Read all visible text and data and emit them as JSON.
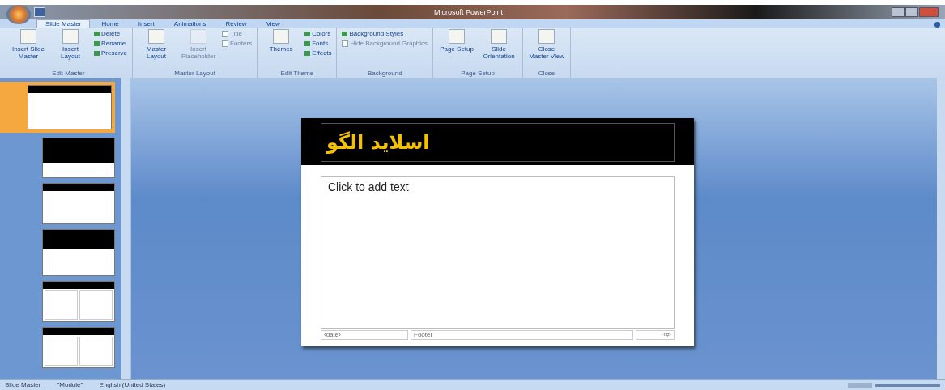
{
  "window": {
    "title": "Microsoft PowerPoint"
  },
  "tabs": [
    {
      "label": "Slide Master",
      "selected": true
    },
    {
      "label": "Home",
      "selected": false
    },
    {
      "label": "Insert",
      "selected": false
    },
    {
      "label": "Animations",
      "selected": false
    },
    {
      "label": "Review",
      "selected": false
    },
    {
      "label": "View",
      "selected": false
    }
  ],
  "ribbon_groups": [
    {
      "label": "Edit Master",
      "items": [
        {
          "kind": "large",
          "label": "Insert Slide Master",
          "disabled": false
        },
        {
          "kind": "large",
          "label": "Insert Layout",
          "disabled": false
        },
        {
          "kind": "small",
          "label": "Delete",
          "disabled": false
        },
        {
          "kind": "small",
          "label": "Rename",
          "disabled": false
        },
        {
          "kind": "small",
          "label": "Preserve",
          "disabled": false
        }
      ]
    },
    {
      "label": "Master Layout",
      "items": [
        {
          "kind": "large",
          "label": "Master Layout",
          "disabled": false
        },
        {
          "kind": "large",
          "label": "Insert Placeholder",
          "disabled": true
        },
        {
          "kind": "check",
          "label": "Title",
          "disabled": true
        },
        {
          "kind": "check",
          "label": "Footers",
          "disabled": true
        }
      ]
    },
    {
      "label": "Edit Theme",
      "items": [
        {
          "kind": "large",
          "label": "Themes",
          "disabled": false
        },
        {
          "kind": "small",
          "label": "Colors",
          "disabled": false
        },
        {
          "kind": "small",
          "label": "Fonts",
          "disabled": false
        },
        {
          "kind": "small",
          "label": "Effects",
          "disabled": false
        }
      ]
    },
    {
      "label": "Background",
      "items": [
        {
          "kind": "small",
          "label": "Background Styles",
          "disabled": false
        },
        {
          "kind": "check",
          "label": "Hide Background Graphics",
          "disabled": true
        }
      ]
    },
    {
      "label": "Page Setup",
      "items": [
        {
          "kind": "large",
          "label": "Page Setup",
          "disabled": false
        },
        {
          "kind": "large",
          "label": "Slide Orientation",
          "disabled": false
        }
      ]
    },
    {
      "label": "Close",
      "items": [
        {
          "kind": "large",
          "label": "Close Master View",
          "disabled": false
        }
      ]
    }
  ],
  "thumbnails": [
    {
      "kind": "master",
      "selected": true
    },
    {
      "kind": "title",
      "selected": false
    },
    {
      "kind": "content",
      "selected": false
    },
    {
      "kind": "section",
      "selected": false
    },
    {
      "kind": "two",
      "selected": false
    },
    {
      "kind": "two",
      "selected": false
    }
  ],
  "slide": {
    "title": "اسلاید الگو",
    "body": "Click to add text",
    "footer": [
      "‹date›",
      "Footer",
      "‹#›"
    ]
  },
  "status_bar": [
    "Slide Master",
    "\"Module\"",
    "English (United States)"
  ]
}
